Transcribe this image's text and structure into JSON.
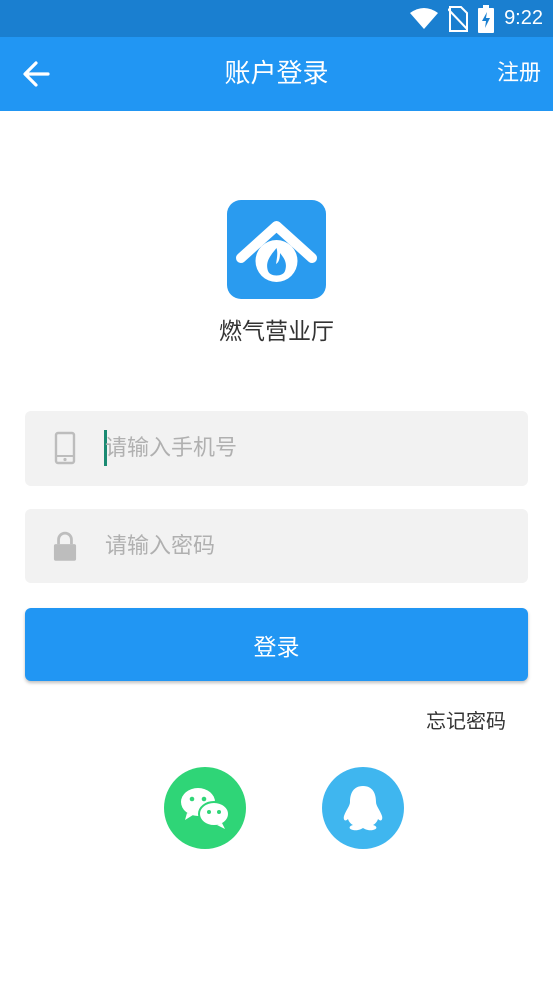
{
  "status_bar": {
    "time": "9:22"
  },
  "header": {
    "title": "账户登录",
    "register_label": "注册"
  },
  "app": {
    "name": "燃气营业厅"
  },
  "form": {
    "phone_placeholder": "请输入手机号",
    "password_placeholder": "请输入密码",
    "login_label": "登录",
    "forgot_label": "忘记密码"
  },
  "social": [
    "wechat-icon",
    "qq-icon"
  ],
  "colors": {
    "primary": "#2196f3",
    "status_bar": "#1a7fd0",
    "field_bg": "#f2f2f2",
    "wechat": "#2fd577",
    "qq": "#3fb6ef"
  }
}
